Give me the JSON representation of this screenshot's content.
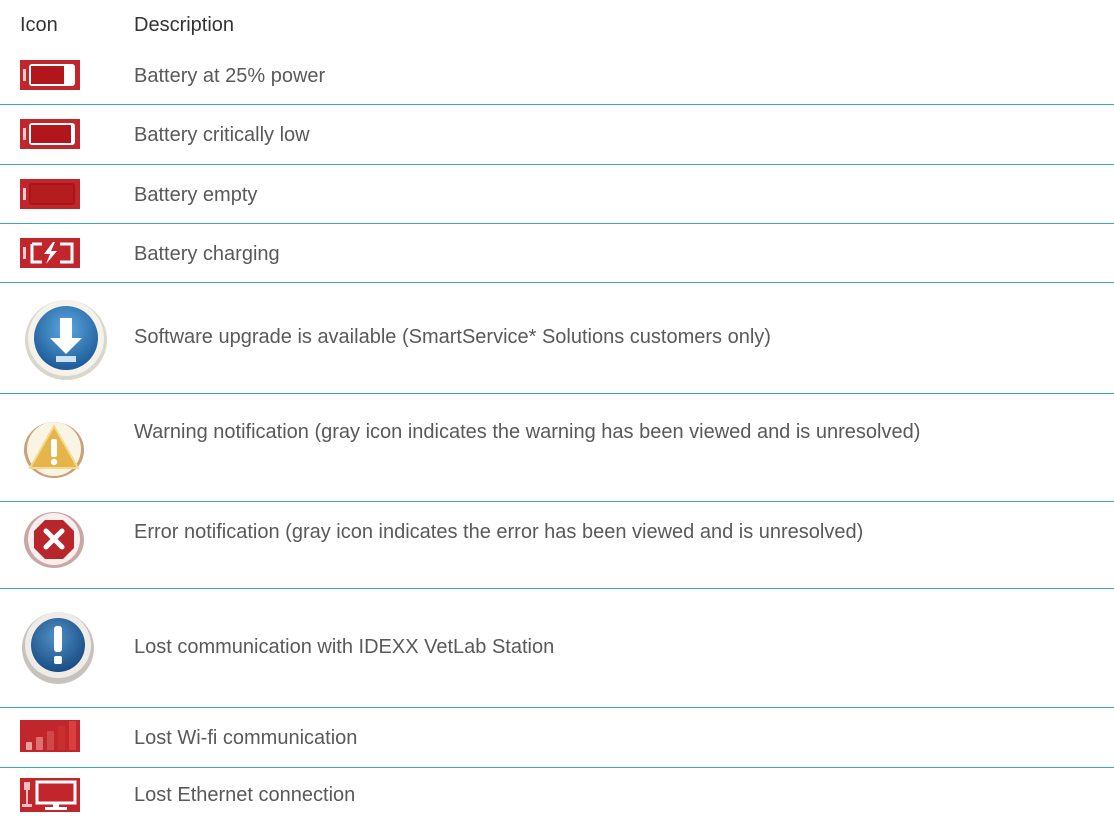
{
  "header": {
    "icon": "Icon",
    "description": "Description"
  },
  "rows": [
    {
      "icon": "battery-25-icon",
      "text": "Battery at 25% power"
    },
    {
      "icon": "battery-critical-icon",
      "text": "Battery critically low"
    },
    {
      "icon": "battery-empty-icon",
      "text": "Battery empty"
    },
    {
      "icon": "battery-charging-icon",
      "text": "Battery charging"
    },
    {
      "icon": "software-upgrade-icon",
      "text": "Software upgrade is available (SmartService* Solutions customers only)"
    },
    {
      "icon": "warning-icon",
      "text": "Warning notification (gray icon indicates the warning has been viewed and is unresolved)"
    },
    {
      "icon": "error-icon",
      "text": "Error notification (gray icon indicates the error has been viewed and is unresolved)"
    },
    {
      "icon": "lost-communication-icon",
      "text": "Lost communication with IDEXX VetLab Station"
    },
    {
      "icon": "wifi-lost-icon",
      "text": "Lost Wi-fi communication"
    },
    {
      "icon": "ethernet-lost-icon",
      "text": "Lost Ethernet connection"
    }
  ],
  "colors": {
    "divider": "#3aa9b7",
    "alert_red": "#c0262b",
    "info_blue": "#2c6fa8"
  }
}
